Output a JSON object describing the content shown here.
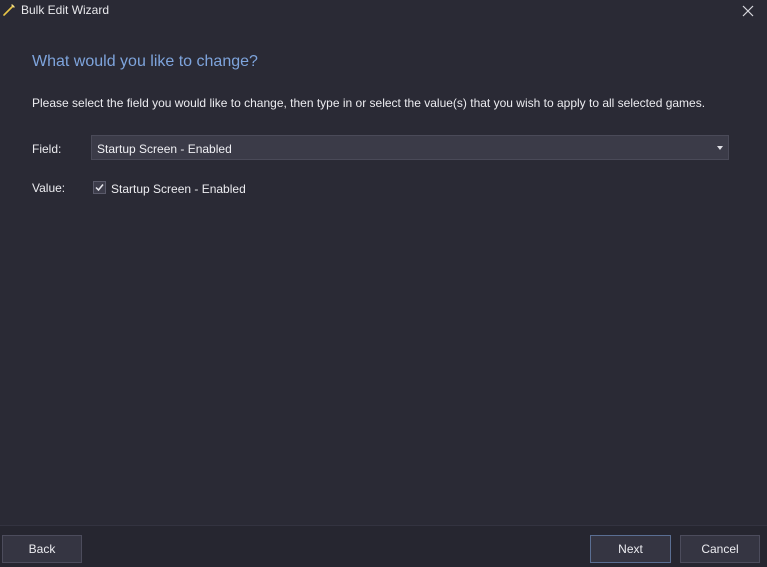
{
  "window": {
    "title": "Bulk Edit Wizard",
    "icon": "wand-icon"
  },
  "main": {
    "heading": "What would you like to change?",
    "instructions": "Please select the field you would like to change, then type in or select the value(s) that you wish to apply to all selected games.",
    "field_label": "Field:",
    "field_value": "Startup Screen - Enabled",
    "value_label": "Value:",
    "checkbox_label": "Startup Screen - Enabled",
    "checkbox_checked": true
  },
  "footer": {
    "back_label": "Back",
    "next_label": "Next",
    "cancel_label": "Cancel"
  },
  "colors": {
    "background": "#2a2a35",
    "heading_accent": "#7ea4dc",
    "wand_icon": "#e8c547"
  }
}
